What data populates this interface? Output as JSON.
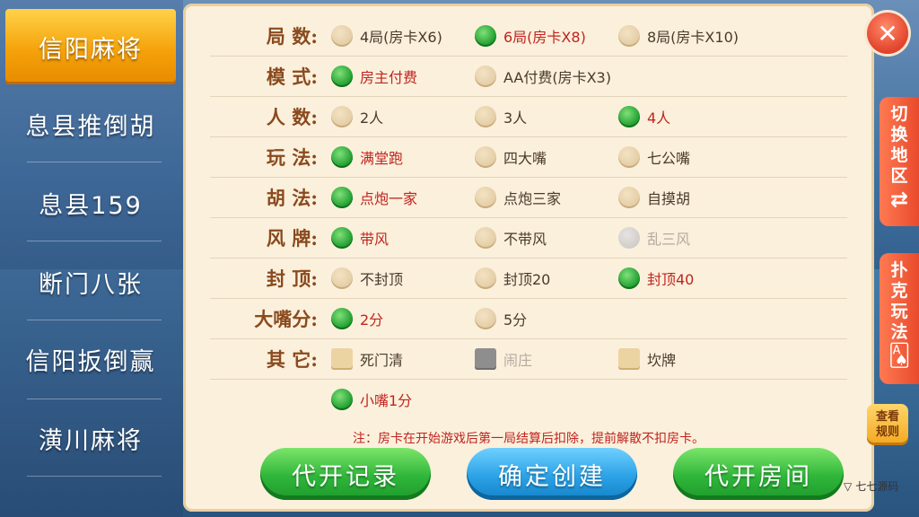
{
  "sidebar": {
    "items": [
      {
        "label": "信阳麻将",
        "active": true
      },
      {
        "label": "息县推倒胡",
        "active": false
      },
      {
        "label": "息县159",
        "active": false
      },
      {
        "label": "断门八张",
        "active": false
      },
      {
        "label": "信阳扳倒赢",
        "active": false
      },
      {
        "label": "潢川麻将",
        "active": false
      }
    ]
  },
  "rows": [
    {
      "label": "局  数:",
      "options": [
        {
          "text": "4局(房卡X6)",
          "state": "off"
        },
        {
          "text": "6局(房卡X8)",
          "state": "on"
        },
        {
          "text": "8局(房卡X10)",
          "state": "off"
        }
      ]
    },
    {
      "label": "模  式:",
      "options": [
        {
          "text": "房主付费",
          "state": "on"
        },
        {
          "text": "AA付费(房卡X3)",
          "state": "off"
        }
      ]
    },
    {
      "label": "人  数:",
      "options": [
        {
          "text": "2人",
          "state": "off"
        },
        {
          "text": "3人",
          "state": "off"
        },
        {
          "text": "4人",
          "state": "on"
        }
      ]
    },
    {
      "label": "玩  法:",
      "options": [
        {
          "text": "满堂跑",
          "state": "on"
        },
        {
          "text": "四大嘴",
          "state": "off"
        },
        {
          "text": "七公嘴",
          "state": "off"
        }
      ]
    },
    {
      "label": "胡  法:",
      "options": [
        {
          "text": "点炮一家",
          "state": "on"
        },
        {
          "text": "点炮三家",
          "state": "off"
        },
        {
          "text": "自摸胡",
          "state": "off"
        }
      ]
    },
    {
      "label": "风  牌:",
      "options": [
        {
          "text": "带风",
          "state": "on"
        },
        {
          "text": "不带风",
          "state": "off"
        },
        {
          "text": "乱三风",
          "state": "disabled"
        }
      ]
    },
    {
      "label": "封  顶:",
      "options": [
        {
          "text": "不封顶",
          "state": "off"
        },
        {
          "text": "封顶20",
          "state": "off"
        },
        {
          "text": "封顶40",
          "state": "on"
        }
      ]
    },
    {
      "label": "大嘴分:",
      "options": [
        {
          "text": "2分",
          "state": "on"
        },
        {
          "text": "5分",
          "state": "off"
        }
      ]
    },
    {
      "label": "其  它:",
      "options": [
        {
          "text": "死门清",
          "state": "off",
          "kind": "check"
        },
        {
          "text": "闹庄",
          "state": "disabled",
          "kind": "check"
        },
        {
          "text": "坎牌",
          "state": "off",
          "kind": "check"
        }
      ]
    },
    {
      "label": "",
      "options": [
        {
          "text": "小嘴1分",
          "state": "on"
        }
      ]
    }
  ],
  "note": "注：房卡在开始游戏后第一局结算后扣除，提前解散不扣房卡。",
  "buttons": {
    "record": "代开记录",
    "create": "确定创建",
    "room": "代开房间"
  },
  "right_tabs": {
    "switch_region": "切换地区",
    "poker": "扑克玩法"
  },
  "rules_button": "查看规则",
  "watermark": "七七源码",
  "colors": {
    "selected": "#1c9a2b",
    "accent": "#f5a20a",
    "text_selected": "#c0241f"
  }
}
